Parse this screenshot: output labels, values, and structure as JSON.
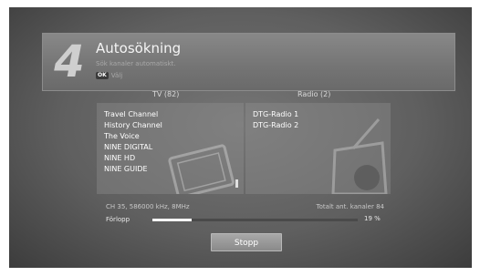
{
  "header": {
    "step_number": "4",
    "title": "Autosökning",
    "subtitle": "Sök kanaler automatiskt.",
    "ok_key": "OK",
    "ok_label": "Välj"
  },
  "tv": {
    "header": "TV (82)",
    "channels": [
      "Travel Channel",
      "History Channel",
      "The Voice",
      "NINE DIGITAL",
      "NINE HD",
      "NINE GUIDE"
    ]
  },
  "radio": {
    "header": "Radio (2)",
    "channels": [
      "DTG-Radio 1",
      "DTG-Radio 2"
    ]
  },
  "status": {
    "frequency": "CH 35, 586000 kHz, 8MHz",
    "total": "Totalt ant. kanaler 84"
  },
  "progress": {
    "label": "Förlopp",
    "percent_text": "19 %",
    "fraction": 0.19
  },
  "stop_button": "Stopp",
  "icons": {
    "tv": "tv-watermark-icon",
    "radio": "radio-watermark-icon"
  }
}
